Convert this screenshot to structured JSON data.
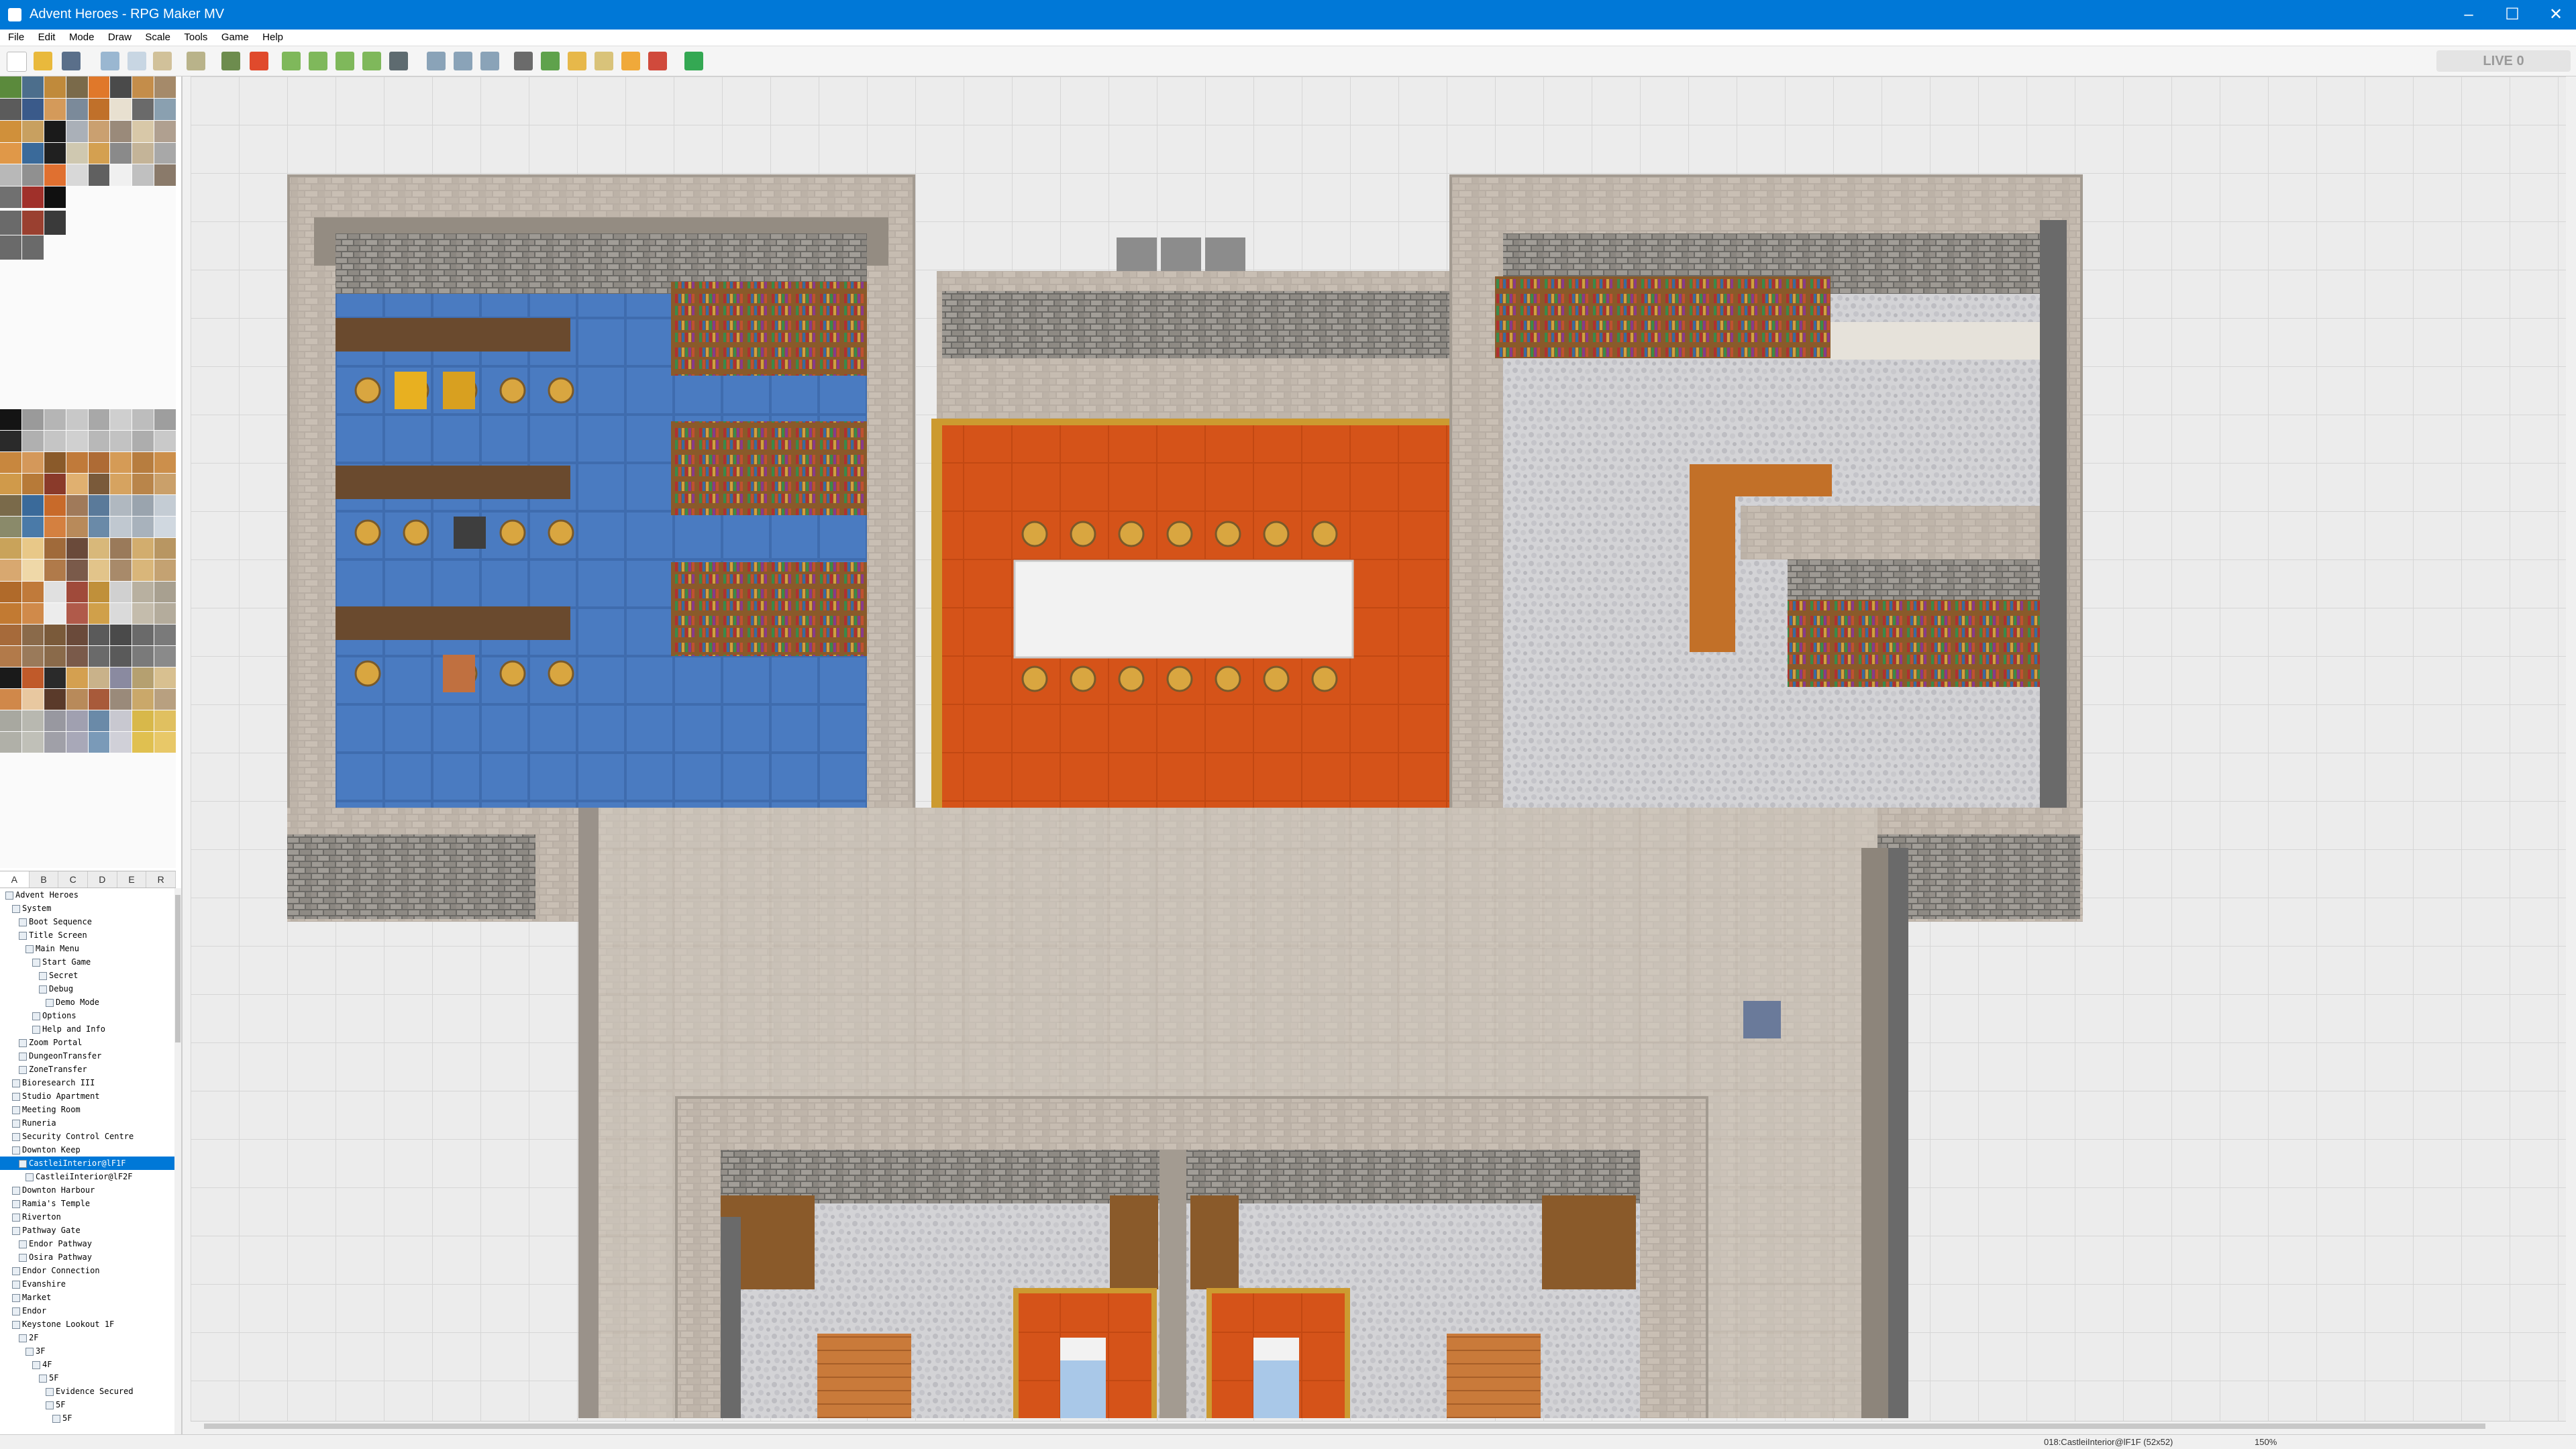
{
  "window": {
    "title": "Advent Heroes - RPG Maker MV"
  },
  "menu": [
    "File",
    "Edit",
    "Mode",
    "Draw",
    "Scale",
    "Tools",
    "Game",
    "Help"
  ],
  "toolbar": {
    "live_label": "LIVE",
    "live_count": "0"
  },
  "palette_tabs": [
    "A",
    "B",
    "C",
    "D",
    "E",
    "R"
  ],
  "map_tree": [
    {
      "label": "Advent Heroes",
      "depth": 0
    },
    {
      "label": "System",
      "depth": 1
    },
    {
      "label": "Boot Sequence",
      "depth": 2
    },
    {
      "label": "Title Screen",
      "depth": 2
    },
    {
      "label": "Main Menu",
      "depth": 3
    },
    {
      "label": "Start Game",
      "depth": 4
    },
    {
      "label": "Secret",
      "depth": 5
    },
    {
      "label": "Debug",
      "depth": 5
    },
    {
      "label": "Demo Mode",
      "depth": 6
    },
    {
      "label": "Options",
      "depth": 4
    },
    {
      "label": "Help and Info",
      "depth": 4
    },
    {
      "label": "Zoom Portal",
      "depth": 2
    },
    {
      "label": "DungeonTransfer",
      "depth": 2
    },
    {
      "label": "ZoneTransfer",
      "depth": 2
    },
    {
      "label": "Bioresearch III",
      "depth": 1
    },
    {
      "label": "Studio Apartment",
      "depth": 1
    },
    {
      "label": "Meeting Room",
      "depth": 1
    },
    {
      "label": "Runeria",
      "depth": 1
    },
    {
      "label": "Security Control Centre",
      "depth": 1
    },
    {
      "label": "Downton Keep",
      "depth": 1
    },
    {
      "label": "CastleiInterior@lF1F",
      "depth": 2,
      "selected": true
    },
    {
      "label": "CastleiInterior@lF2F",
      "depth": 3
    },
    {
      "label": "Downton Harbour",
      "depth": 1
    },
    {
      "label": "Ramia's Temple",
      "depth": 1
    },
    {
      "label": "Riverton",
      "depth": 1
    },
    {
      "label": "Pathway Gate",
      "depth": 1
    },
    {
      "label": "Endor Pathway",
      "depth": 2
    },
    {
      "label": "Osira Pathway",
      "depth": 2
    },
    {
      "label": "Endor Connection",
      "depth": 1
    },
    {
      "label": "Evanshire",
      "depth": 1
    },
    {
      "label": "Market",
      "depth": 1
    },
    {
      "label": "Endor",
      "depth": 1
    },
    {
      "label": "Keystone Lookout 1F",
      "depth": 1
    },
    {
      "label": "2F",
      "depth": 2
    },
    {
      "label": "3F",
      "depth": 3
    },
    {
      "label": "4F",
      "depth": 4
    },
    {
      "label": "5F",
      "depth": 5
    },
    {
      "label": "Evidence Secured",
      "depth": 6
    },
    {
      "label": "5F",
      "depth": 6
    },
    {
      "label": "5F",
      "depth": 7
    }
  ],
  "status": {
    "map": "018:CastleiInterior@lF1F (52x52)",
    "zoom": "150%"
  },
  "colors": {
    "titlebar": "#0078d7",
    "selection": "#0078d7",
    "carpet": "#d4531a",
    "floor_blue": "#4d7cbf",
    "wall": "#8e877f"
  }
}
